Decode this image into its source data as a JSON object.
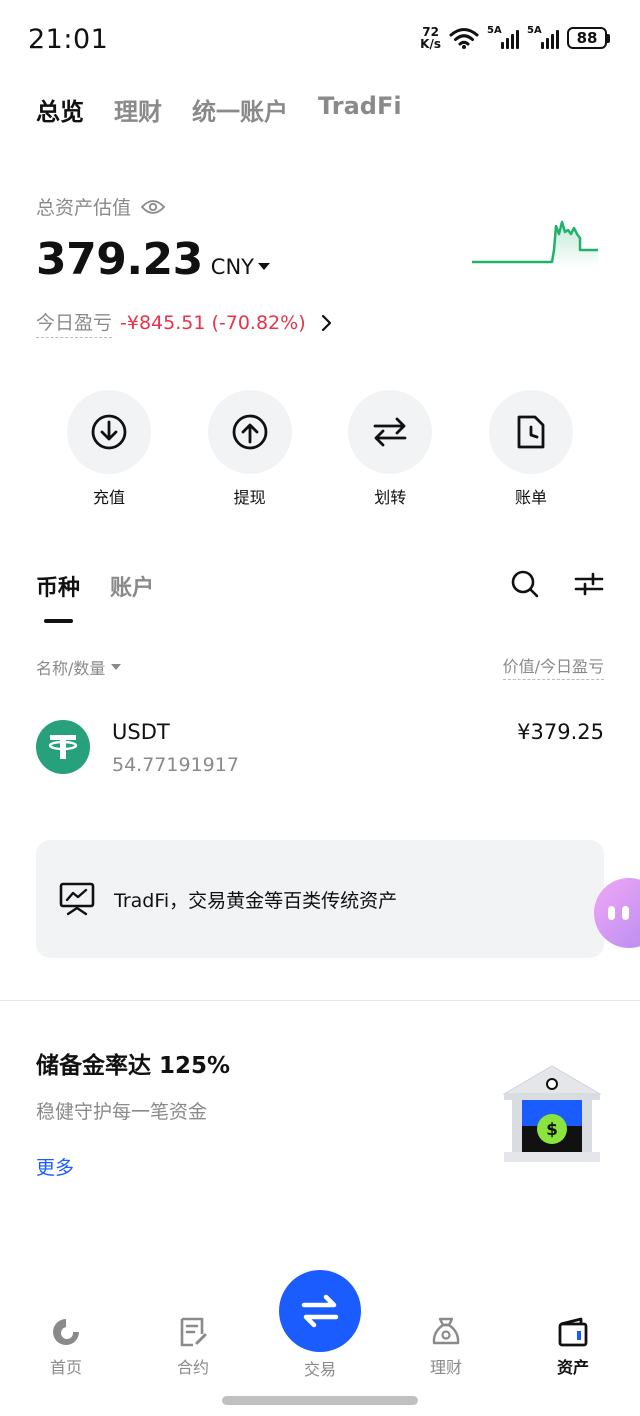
{
  "status_bar": {
    "time": "21:01",
    "net_speed_value": "72",
    "net_speed_unit": "K/s",
    "signal1_label": "5A",
    "signal2_label": "5A",
    "battery": "88"
  },
  "top_tabs": [
    {
      "label": "总览",
      "active": true
    },
    {
      "label": "理财",
      "active": false
    },
    {
      "label": "统一账户",
      "active": false
    },
    {
      "label": "TradFi",
      "active": false
    }
  ],
  "overview": {
    "total_label": "总资产估值",
    "total_value": "379.23",
    "currency": "CNY",
    "today_pnl_label": "今日盈亏",
    "today_pnl_value": "-¥845.51 (-70.82%)",
    "pnl_color": "#e8334a",
    "sparkline_color": "#20b26c"
  },
  "actions": [
    {
      "label": "充值",
      "icon": "deposit-icon"
    },
    {
      "label": "提现",
      "icon": "withdraw-icon"
    },
    {
      "label": "划转",
      "icon": "transfer-icon"
    },
    {
      "label": "账单",
      "icon": "bill-icon"
    }
  ],
  "list_tabs": [
    {
      "label": "币种",
      "active": true
    },
    {
      "label": "账户",
      "active": false
    }
  ],
  "list_header": {
    "left": "名称/数量",
    "right": "价值/今日盈亏"
  },
  "coins": [
    {
      "name": "USDT",
      "amount": "54.77191917",
      "value": "¥379.25",
      "logo_color": "#26a17b"
    }
  ],
  "tradfi_card": {
    "text": "TradFi，交易黄金等百类传统资产"
  },
  "reserve": {
    "title": "储备金率达 125%",
    "subtitle": "稳健守护每一笔资金",
    "more": "更多"
  },
  "bottom_nav": [
    {
      "label": "首页",
      "icon": "home-icon",
      "active": false
    },
    {
      "label": "合约",
      "icon": "contract-icon",
      "active": false
    },
    {
      "label": "交易",
      "icon": "trade-icon",
      "active": false
    },
    {
      "label": "理财",
      "icon": "finance-icon",
      "active": false
    },
    {
      "label": "资产",
      "icon": "wallet-icon",
      "active": true
    }
  ],
  "colors": {
    "accent": "#1a5cff",
    "background": "#ffffff",
    "muted": "#8a8a8a"
  }
}
